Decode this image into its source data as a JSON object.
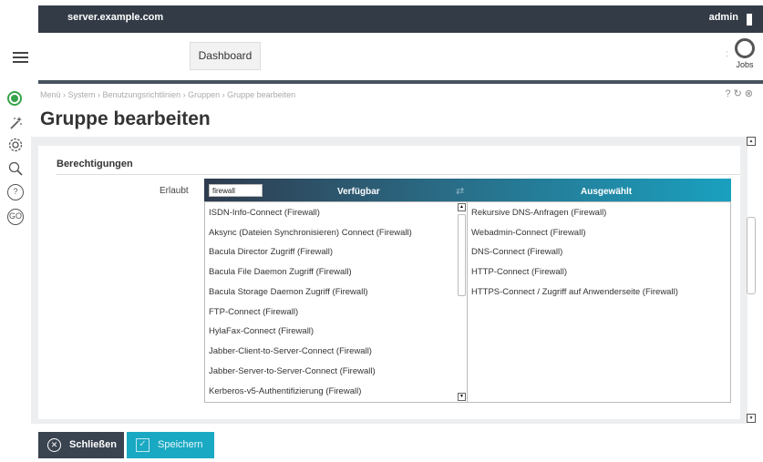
{
  "topbar": {
    "host": "server.example.com",
    "user": "admin"
  },
  "navbar": {
    "dashboard_tab": "Dashboard",
    "jobs_label": "Jobs",
    "more_dots": ":"
  },
  "header": {
    "breadcrumb": "Menü › System › Benutzungsrichtlinien › Gruppen › Gruppe bearbeiten",
    "title": "Gruppe bearbeiten"
  },
  "section": {
    "title": "Berechtigungen",
    "field_label": "Erlaubt",
    "filter_value": "firewall",
    "available_header": "Verfügbar",
    "selected_header": "Ausgewählt",
    "available": [
      "ISDN-Info-Connect (Firewall)",
      "Aksync (Dateien Synchronisieren) Connect (Firewall)",
      "Bacula Director Zugriff (Firewall)",
      "Bacula File Daemon Zugriff (Firewall)",
      "Bacula Storage Daemon Zugriff (Firewall)",
      "FTP-Connect (Firewall)",
      "HylaFax-Connect (Firewall)",
      "Jabber-Client-to-Server-Connect (Firewall)",
      "Jabber-Server-to-Server-Connect (Firewall)",
      "Kerberos-v5-Authentifizierung (Firewall)"
    ],
    "selected": [
      "Rekursive DNS-Anfragen (Firewall)",
      "Webadmin-Connect (Firewall)",
      "DNS-Connect (Firewall)",
      "HTTP-Connect (Firewall)",
      "HTTPS-Connect / Zugriff auf Anwenderseite (Firewall)"
    ]
  },
  "footer": {
    "close_label": "Schließen",
    "save_label": "Speichern"
  },
  "rail": {
    "go_label": "GO",
    "help_label": "?"
  },
  "colors": {
    "accent": "#1aa9c2",
    "status_ok": "#35a44a",
    "dark": "#333b47"
  }
}
